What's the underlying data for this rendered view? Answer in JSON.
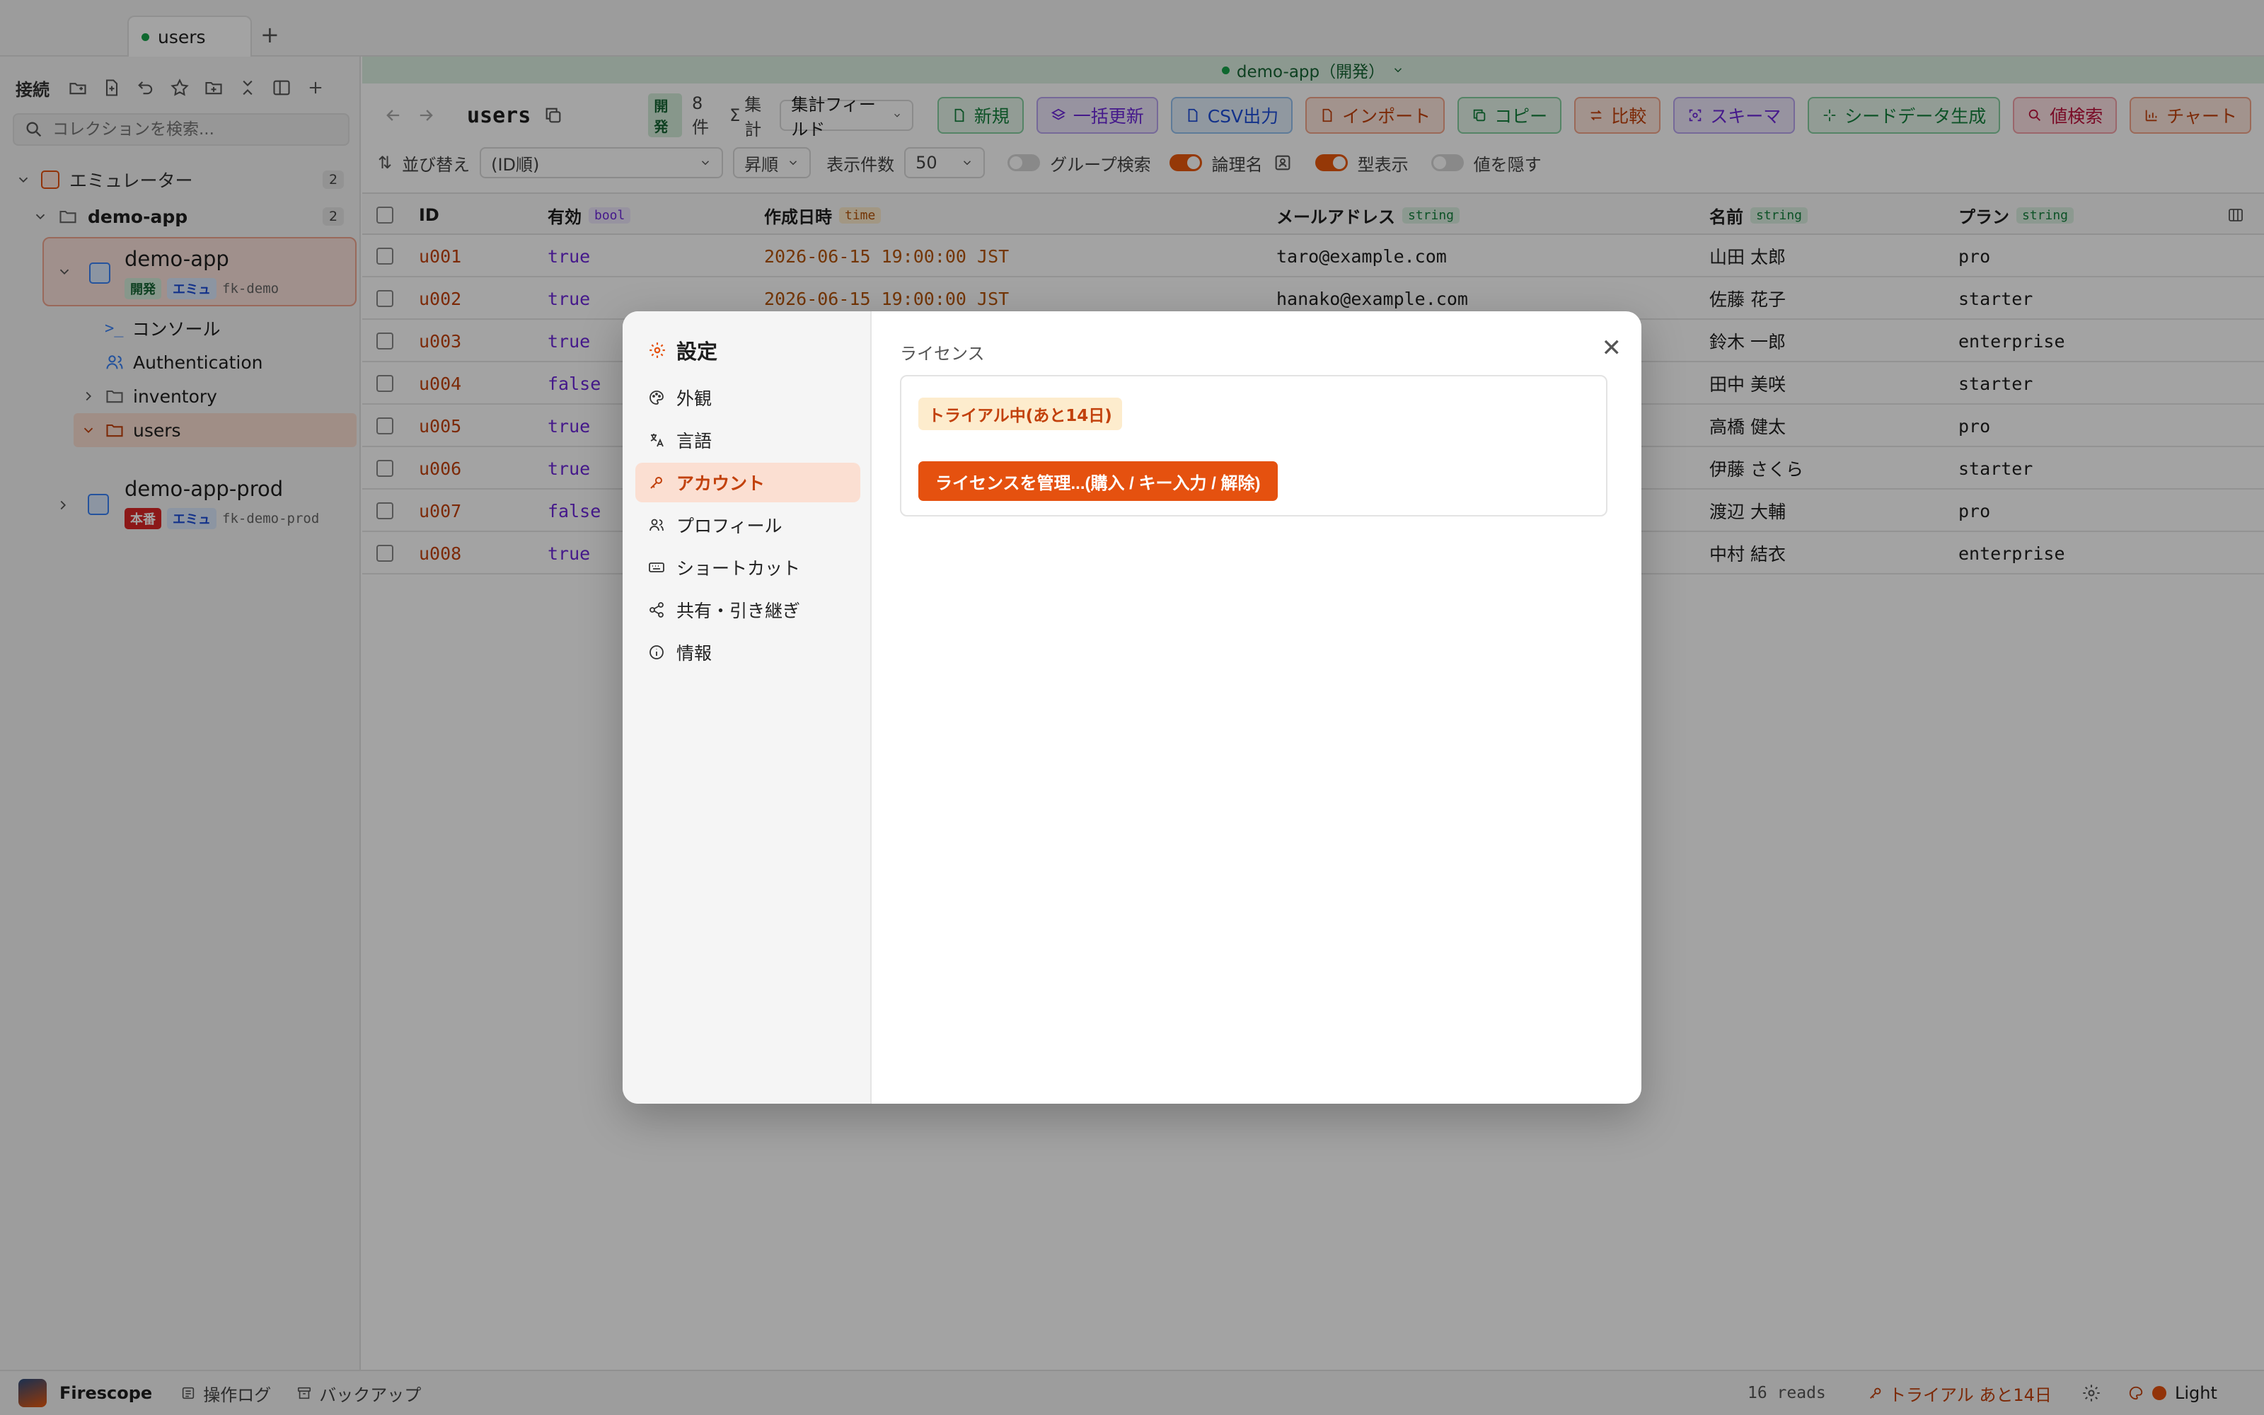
{
  "app": {
    "name": "Firescope"
  },
  "tabs": [
    {
      "label": "users"
    }
  ],
  "sidebar": {
    "header_label": "接続",
    "search_placeholder": "コレクションを検索...",
    "emulator": {
      "label": "エミュレーター",
      "count": "2"
    },
    "project_folder": {
      "label": "demo-app",
      "count": "2"
    },
    "projects": [
      {
        "name": "demo-app",
        "env_badge": "開発",
        "emu_badge": "エミュ",
        "id": "fk-demo"
      },
      {
        "name": "demo-app-prod",
        "env_badge": "本番",
        "emu_badge": "エミュ",
        "id": "fk-demo-prod"
      }
    ],
    "children": [
      "コンソール",
      "Authentication",
      "inventory",
      "users"
    ]
  },
  "env_bar": {
    "label": "demo-app（開発）"
  },
  "toolbar": {
    "collection": "users",
    "env_badge": "開発",
    "doc_count": "8 件",
    "aggregate_label": "集計",
    "aggregate_select": "集計フィールド",
    "buttons": {
      "new": "新規",
      "bulk_update": "一括更新",
      "csv": "CSV出力",
      "import": "インポート",
      "copy": "コピー",
      "compare": "比較",
      "schema": "スキーマ",
      "seed": "シードデータ生成",
      "value_search": "値検索",
      "chart": "チャート"
    }
  },
  "options": {
    "sort_label": "並び替え",
    "sort_value": "(ID順)",
    "order_value": "昇順",
    "page_size_label": "表示件数",
    "page_size_value": "50",
    "group_search_label": "グループ検索",
    "logical_name_label": "論理名",
    "type_display_label": "型表示",
    "hide_values_label": "値を隠す"
  },
  "table": {
    "columns": [
      {
        "name": "ID",
        "type": ""
      },
      {
        "name": "有効",
        "type": "bool"
      },
      {
        "name": "作成日時",
        "type": "time"
      },
      {
        "name": "メールアドレス",
        "type": "string"
      },
      {
        "name": "名前",
        "type": "string"
      },
      {
        "name": "プラン",
        "type": "string"
      }
    ],
    "rows": [
      {
        "id": "u001",
        "active": "true",
        "created": "2026-06-15 19:00:00 JST",
        "email": "taro@example.com",
        "name": "山田 太郎",
        "plan": "pro"
      },
      {
        "id": "u002",
        "active": "true",
        "created": "2026-06-15 19:00:00 JST",
        "email": "hanako@example.com",
        "name": "佐藤 花子",
        "plan": "starter"
      },
      {
        "id": "u003",
        "active": "true",
        "created": "",
        "email": "",
        "name": "鈴木 一郎",
        "plan": "enterprise"
      },
      {
        "id": "u004",
        "active": "false",
        "created": "",
        "email": "",
        "name": "田中 美咲",
        "plan": "starter"
      },
      {
        "id": "u005",
        "active": "true",
        "created": "",
        "email": "",
        "name": "高橋 健太",
        "plan": "pro"
      },
      {
        "id": "u006",
        "active": "true",
        "created": "",
        "email": "",
        "name": "伊藤 さくら",
        "plan": "starter"
      },
      {
        "id": "u007",
        "active": "false",
        "created": "",
        "email": "",
        "name": "渡辺 大輔",
        "plan": "pro"
      },
      {
        "id": "u008",
        "active": "true",
        "created": "",
        "email": "",
        "name": "中村 結衣",
        "plan": "enterprise"
      }
    ]
  },
  "status": {
    "operation_log": "操作ログ",
    "backup": "バックアップ",
    "reads": "16 reads",
    "trial": "トライアル あと14日",
    "theme": "Light"
  },
  "settings": {
    "title": "設定",
    "nav": [
      "外観",
      "言語",
      "アカウント",
      "プロフィール",
      "ショートカット",
      "共有・引き継ぎ",
      "情報"
    ],
    "active_index": 2,
    "section_title": "ライセンス",
    "trial_badge": "トライアル中(あと14日)",
    "manage_button": "ライセンスを管理...(購入 / キー入力 / 解除)"
  },
  "colors": {
    "accent": "#e5510f",
    "dev_env": "#16a34a",
    "prod_env": "#dc2626"
  }
}
